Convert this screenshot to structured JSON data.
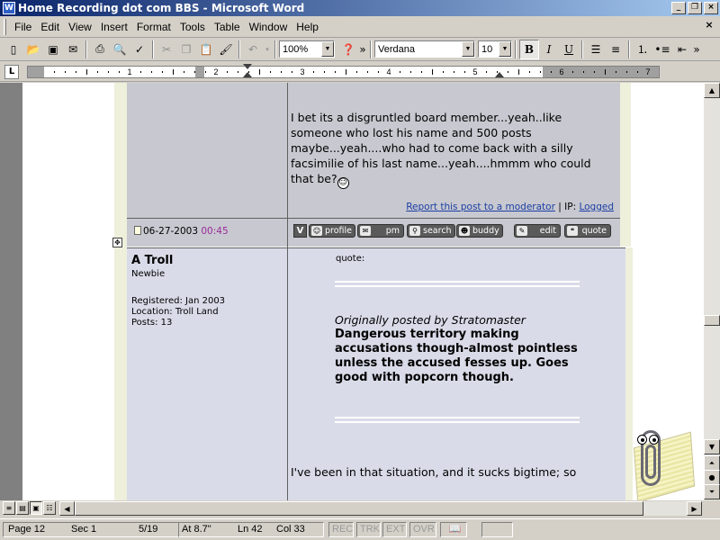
{
  "window": {
    "title": "Home Recording dot com BBS - Microsoft Word",
    "icon": "word-icon",
    "controls": [
      "_",
      "❐",
      "×"
    ]
  },
  "menu": {
    "items": [
      "File",
      "Edit",
      "View",
      "Insert",
      "Format",
      "Tools",
      "Table",
      "Window",
      "Help"
    ],
    "doc_close": "×"
  },
  "toolbar": {
    "zoom": "100%",
    "font": "Verdana",
    "size": "10",
    "bold": "B",
    "italic": "I",
    "underline": "U"
  },
  "ruler": {
    "tab_selector": "L",
    "numbers": [
      "1",
      "2",
      "3",
      "4",
      "5",
      "6",
      "7"
    ]
  },
  "post_prev": {
    "body": "I bet its a disgruntled board member...yeah..like someone who lost his name and 500 posts maybe...yeah....who had to come back with a silly facsimilie of his last name...yeah....hmmm who could that be?",
    "report_link": "Report this post to a moderator",
    "ip_label": " | IP: ",
    "ip_link": "Logged",
    "date": "06-27-2003",
    "time": "00:45"
  },
  "post_buttons": {
    "v": "V",
    "profile": "profile",
    "pm": "pm",
    "search": "search",
    "buddy": "buddy",
    "edit": "edit",
    "quote": "quote"
  },
  "post": {
    "author": "A Troll",
    "rank": "Newbie",
    "registered": "Registered: Jan 2003",
    "location": "Location: Troll Land",
    "posts": "Posts: 13",
    "quote_label": "quote:",
    "quote_by": "Originally posted by Stratomaster",
    "quote_body": "Dangerous territory making accusations though-almost pointless unless the accused fesses up. Goes good with popcorn though.",
    "reply": "I've been in that situation, and it sucks bigtime; so"
  },
  "statusbar": {
    "page": "Page 12",
    "sec": "Sec 1",
    "pages": "5/19",
    "at": "At 8.7\"",
    "ln": "Ln 42",
    "col": "Col 33",
    "rec": "REC",
    "trk": "TRK",
    "ext": "EXT",
    "ovr": "OVR"
  }
}
